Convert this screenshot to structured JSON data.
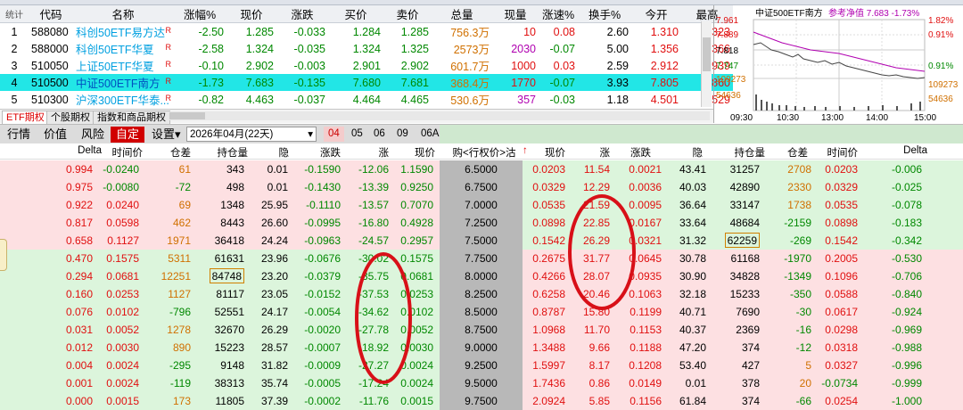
{
  "watchlist": {
    "headers": [
      "统计",
      "代码",
      "名称",
      "涨幅%",
      "现价",
      "涨跌",
      "买价",
      "卖价",
      "总量",
      "现量",
      "涨速%",
      "换手%",
      "今开",
      "最高"
    ],
    "rows": [
      {
        "idx": "1",
        "code": "588080",
        "name": "科创50ETF易方达",
        "flag": "R",
        "chg_pct": "-2.50",
        "price": "1.285",
        "chg": "-0.033",
        "bid": "1.284",
        "ask": "1.285",
        "vol": "756.3万",
        "cur": "10",
        "speed": "0.08",
        "turnover": "2.60",
        "open": "1.310",
        "high": "1.323"
      },
      {
        "idx": "2",
        "code": "588000",
        "name": "科创50ETF华夏",
        "flag": "R",
        "chg_pct": "-2.58",
        "price": "1.324",
        "chg": "-0.035",
        "bid": "1.324",
        "ask": "1.325",
        "vol": "2573万",
        "cur": "2030",
        "speed": "-0.07",
        "turnover": "5.00",
        "open": "1.356",
        "high": "1.366"
      },
      {
        "idx": "3",
        "code": "510050",
        "name": "上证50ETF华夏",
        "flag": "R",
        "chg_pct": "-0.10",
        "price": "2.902",
        "chg": "-0.003",
        "bid": "2.901",
        "ask": "2.902",
        "vol": "601.7万",
        "cur": "1000",
        "speed": "0.03",
        "turnover": "2.59",
        "open": "2.912",
        "high": "2.939"
      },
      {
        "idx": "4",
        "code": "510500",
        "name": "中证500ETF南方",
        "flag": "R",
        "chg_pct": "-1.73",
        "price": "7.683",
        "chg": "-0.135",
        "bid": "7.680",
        "ask": "7.681",
        "vol": "368.4万",
        "cur": "1770",
        "speed": "-0.07",
        "turnover": "3.93",
        "open": "7.805",
        "high": "7.860"
      },
      {
        "idx": "5",
        "code": "510300",
        "name": "沪深300ETF华泰...",
        "flag": "R",
        "chg_pct": "-0.82",
        "price": "4.463",
        "chg": "-0.037",
        "bid": "4.464",
        "ask": "4.465",
        "vol": "530.6万",
        "cur": "357",
        "speed": "-0.03",
        "turnover": "1.18",
        "open": "4.501",
        "high": "4.529"
      }
    ]
  },
  "mini_chart": {
    "title": "中证500ETF南方",
    "legend": "参考净值 7.683 -1.73%",
    "y_left": [
      "7.961",
      "7.889",
      "7.818",
      "7.747",
      "109273",
      "54636"
    ],
    "y_right": [
      "1.82%",
      "0.91%",
      "0.91%",
      "109273",
      "54636"
    ],
    "x_ticks": [
      "09:30",
      "10:30",
      "13:00",
      "14:00",
      "15:00"
    ]
  },
  "tabs": [
    "ETF期权",
    "个股期权",
    "指数和商品期权"
  ],
  "toolbar": {
    "items": [
      "行情",
      "价值",
      "风险"
    ],
    "custom": "自定",
    "settings": "设置▾",
    "expiry": "2026年04月(22天)",
    "months": [
      "04",
      "05",
      "06",
      "09",
      "06A"
    ],
    "active_month": "04"
  },
  "option_headers": {
    "call": [
      "Delta",
      "时间价",
      "仓差",
      "持仓量",
      "隐波%",
      "涨跌",
      "涨幅%",
      "现价"
    ],
    "strike": "购<行权价>沽",
    "put": [
      "现价",
      "涨幅%",
      "涨跌",
      "隐波%",
      "持仓量",
      "仓差",
      "时间价",
      "Delta"
    ]
  },
  "option_rows": [
    {
      "c": [
        "0.994",
        "-0.0240",
        "61",
        "343",
        "0.01",
        "-0.1590",
        "-12.06",
        "1.1590"
      ],
      "k": "6.5000",
      "p": [
        "0.0203",
        "11.54",
        "0.0021",
        "43.41",
        "31257",
        "2708",
        "0.0203",
        "-0.006"
      ],
      "itm": "call"
    },
    {
      "c": [
        "0.975",
        "-0.0080",
        "-72",
        "498",
        "0.01",
        "-0.1430",
        "-13.39",
        "0.9250"
      ],
      "k": "6.7500",
      "p": [
        "0.0329",
        "12.29",
        "0.0036",
        "40.03",
        "42890",
        "2330",
        "0.0329",
        "-0.025"
      ],
      "itm": "call"
    },
    {
      "c": [
        "0.922",
        "0.0240",
        "69",
        "1348",
        "25.95",
        "-0.1110",
        "-13.57",
        "0.7070"
      ],
      "k": "7.0000",
      "p": [
        "0.0535",
        "21.59",
        "0.0095",
        "36.64",
        "33147",
        "1738",
        "0.0535",
        "-0.078"
      ],
      "itm": "call"
    },
    {
      "c": [
        "0.817",
        "0.0598",
        "462",
        "8443",
        "26.60",
        "-0.0995",
        "-16.80",
        "0.4928"
      ],
      "k": "7.2500",
      "p": [
        "0.0898",
        "22.85",
        "0.0167",
        "33.64",
        "48684",
        "-2159",
        "0.0898",
        "-0.183"
      ],
      "itm": "call"
    },
    {
      "c": [
        "0.658",
        "0.1127",
        "1971",
        "36418",
        "24.24",
        "-0.0963",
        "-24.57",
        "0.2957"
      ],
      "k": "7.5000",
      "p": [
        "0.1542",
        "26.29",
        "0.0321",
        "31.32",
        "62259",
        "-269",
        "0.1542",
        "-0.342"
      ],
      "itm": "call"
    },
    {
      "c": [
        "0.470",
        "0.1575",
        "5311",
        "61631",
        "23.96",
        "-0.0676",
        "-30.02",
        "0.1575"
      ],
      "k": "7.7500",
      "p": [
        "0.2675",
        "31.77",
        "0.0645",
        "30.78",
        "61168",
        "-1970",
        "0.2005",
        "-0.530"
      ],
      "itm": "put"
    },
    {
      "c": [
        "0.294",
        "0.0681",
        "12251",
        "84748",
        "23.20",
        "-0.0379",
        "-35.75",
        "0.0681"
      ],
      "k": "8.0000",
      "p": [
        "0.4266",
        "28.07",
        "0.0935",
        "30.90",
        "34828",
        "-1349",
        "0.1096",
        "-0.706"
      ],
      "itm": "put"
    },
    {
      "c": [
        "0.160",
        "0.0253",
        "1127",
        "81117",
        "23.05",
        "-0.0152",
        "-37.53",
        "0.0253"
      ],
      "k": "8.2500",
      "p": [
        "0.6258",
        "20.46",
        "0.1063",
        "32.18",
        "15233",
        "-350",
        "0.0588",
        "-0.840"
      ],
      "itm": "put"
    },
    {
      "c": [
        "0.076",
        "0.0102",
        "-796",
        "52551",
        "24.17",
        "-0.0054",
        "-34.62",
        "0.0102"
      ],
      "k": "8.5000",
      "p": [
        "0.8787",
        "15.80",
        "0.1199",
        "40.71",
        "7690",
        "-30",
        "0.0617",
        "-0.924"
      ],
      "itm": "put"
    },
    {
      "c": [
        "0.031",
        "0.0052",
        "1278",
        "32670",
        "26.29",
        "-0.0020",
        "-27.78",
        "0.0052"
      ],
      "k": "8.7500",
      "p": [
        "1.0968",
        "11.70",
        "0.1153",
        "40.37",
        "2369",
        "-16",
        "0.0298",
        "-0.969"
      ],
      "itm": "put"
    },
    {
      "c": [
        "0.012",
        "0.0030",
        "890",
        "15223",
        "28.57",
        "-0.0007",
        "-18.92",
        "0.0030"
      ],
      "k": "9.0000",
      "p": [
        "1.3488",
        "9.66",
        "0.1188",
        "47.20",
        "374",
        "-12",
        "0.0318",
        "-0.988"
      ],
      "itm": "put"
    },
    {
      "c": [
        "0.004",
        "0.0024",
        "-295",
        "9148",
        "31.82",
        "-0.0009",
        "-27.27",
        "0.0024"
      ],
      "k": "9.2500",
      "p": [
        "1.5997",
        "8.17",
        "0.1208",
        "53.40",
        "427",
        "5",
        "0.0327",
        "-0.996"
      ],
      "itm": "put"
    },
    {
      "c": [
        "0.001",
        "0.0024",
        "-119",
        "38313",
        "35.74",
        "-0.0005",
        "-17.24",
        "0.0024"
      ],
      "k": "9.5000",
      "p": [
        "1.7436",
        "0.86",
        "0.0149",
        "0.01",
        "378",
        "20",
        "-0.0734",
        "-0.999"
      ],
      "itm": "put"
    },
    {
      "c": [
        "0.000",
        "0.0015",
        "173",
        "11805",
        "37.39",
        "-0.0002",
        "-11.76",
        "0.0015"
      ],
      "k": "9.7500",
      "p": [
        "2.0924",
        "5.85",
        "0.1156",
        "61.84",
        "374",
        "-66",
        "0.0254",
        "-1.000"
      ],
      "itm": "put"
    }
  ]
}
